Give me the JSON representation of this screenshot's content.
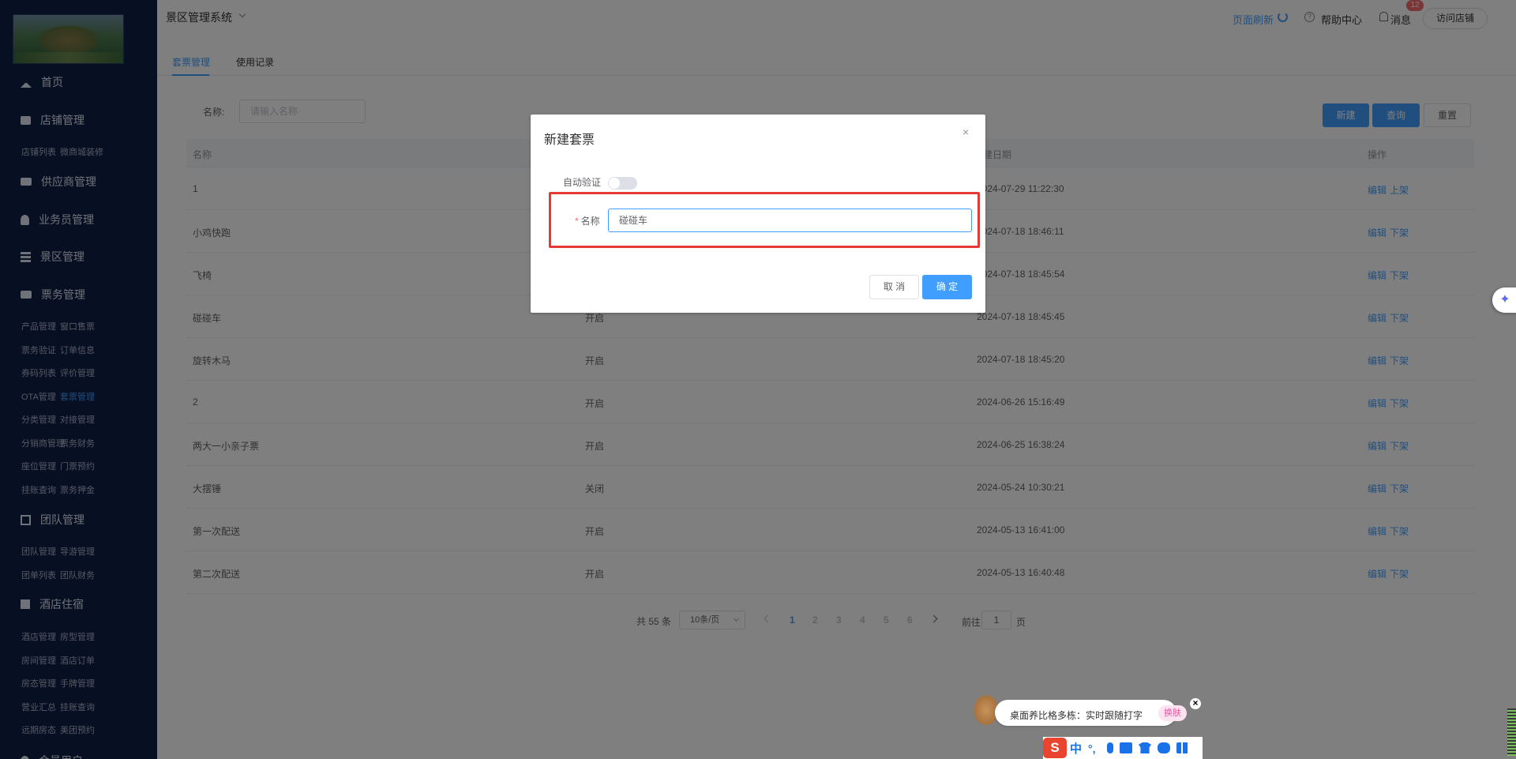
{
  "sidebar": {
    "groups": [
      {
        "label": "首页",
        "icon": "home-icon"
      },
      {
        "label": "店铺管理",
        "icon": "store-icon"
      },
      {
        "label": "供应商管理",
        "icon": "truck-icon"
      },
      {
        "label": "业务员管理",
        "icon": "user-icon"
      },
      {
        "label": "景区管理",
        "icon": "stack-icon"
      },
      {
        "label": "票务管理",
        "icon": "ticket-icon"
      },
      {
        "label": "团队管理",
        "icon": "cube-icon"
      },
      {
        "label": "酒店住宿",
        "icon": "hotel-icon"
      },
      {
        "label": "会员用户",
        "icon": "member-icon"
      }
    ],
    "shop_sub": [
      "店铺列表",
      "微商城装修"
    ],
    "ticket_sub": [
      [
        "产品管理",
        "窗口售票"
      ],
      [
        "票务验证",
        "订单信息"
      ],
      [
        "券码列表",
        "评价管理"
      ],
      [
        "OTA管理",
        "套票管理"
      ],
      [
        "分类管理",
        "对接管理"
      ],
      [
        "分销商管理",
        "票务财务"
      ],
      [
        "座位管理",
        "门票预约"
      ],
      [
        "挂账查询",
        "票务押金"
      ]
    ],
    "team_sub": [
      [
        "团队管理",
        "导游管理"
      ],
      [
        "团单列表",
        "团队财务"
      ]
    ],
    "hotel_sub": [
      [
        "酒店管理",
        "房型管理"
      ],
      [
        "房间管理",
        "酒店订单"
      ],
      [
        "房态管理",
        "手牌管理"
      ],
      [
        "营业汇总",
        "挂账查询"
      ],
      [
        "远期房态",
        "美团预约"
      ]
    ],
    "active_item": "套票管理"
  },
  "header": {
    "system_title": "景区管理系统",
    "refresh": "页面刷新",
    "help": "帮助中心",
    "messages": "消息",
    "message_count": "12",
    "visit_store": "访问店铺"
  },
  "tabs": [
    {
      "label": "套票管理",
      "active": true
    },
    {
      "label": "使用记录",
      "active": false
    }
  ],
  "search": {
    "name_label": "名称:",
    "placeholder": "请输入名称",
    "new_button": "新建",
    "query_button": "查询",
    "reset_button": "重置"
  },
  "table": {
    "headers": {
      "name": "名称",
      "date": "建日期",
      "action": "操作"
    },
    "rows": [
      {
        "name": "1",
        "status": "",
        "date": "2024-07-29 11:22:30",
        "edit": "编辑",
        "toggle": "上架"
      },
      {
        "name": "小鸡快跑",
        "status": "",
        "date": "2024-07-18 18:46:11",
        "edit": "编辑",
        "toggle": "下架"
      },
      {
        "name": "飞椅",
        "status": "",
        "date": "2024-07-18 18:45:54",
        "edit": "编辑",
        "toggle": "下架"
      },
      {
        "name": "碰碰车",
        "status": "开启",
        "date": "2024-07-18 18:45:45",
        "edit": "编辑",
        "toggle": "下架"
      },
      {
        "name": "旋转木马",
        "status": "开启",
        "date": "2024-07-18 18:45:20",
        "edit": "编辑",
        "toggle": "下架"
      },
      {
        "name": "2",
        "status": "开启",
        "date": "2024-06-26 15:16:49",
        "edit": "编辑",
        "toggle": "下架"
      },
      {
        "name": "两大一小亲子票",
        "status": "开启",
        "date": "2024-06-25 16:38:24",
        "edit": "编辑",
        "toggle": "下架"
      },
      {
        "name": "大摆锤",
        "status": "关闭",
        "date": "2024-05-24 10:30:21",
        "edit": "编辑",
        "toggle": "下架"
      },
      {
        "name": "第一次配送",
        "status": "开启",
        "date": "2024-05-13 16:41:00",
        "edit": "编辑",
        "toggle": "下架"
      },
      {
        "name": "第二次配送",
        "status": "开启",
        "date": "2024-05-13 16:40:48",
        "edit": "编辑",
        "toggle": "下架"
      }
    ]
  },
  "pagination": {
    "total": "共 55 条",
    "page_size": "10条/页",
    "pages": [
      "1",
      "2",
      "3",
      "4",
      "5",
      "6"
    ],
    "current": "1",
    "goto_label": "前往",
    "goto_value": "1",
    "page_suffix": "页"
  },
  "dialog": {
    "title": "新建套票",
    "close": "×",
    "auto_verify_label": "自动验证",
    "auto_verify_on": false,
    "name_required": "*",
    "name_label": "名称",
    "name_value": "碰碰车",
    "cancel": "取 消",
    "confirm": "确 定"
  },
  "ime": {
    "tip": "桌面养比格多栋：实时跟随打字",
    "chip": "换肤",
    "close": "×",
    "logo": "S",
    "mode": "中",
    "punct": "°,"
  },
  "assistant": {
    "icon": "sparkle-icon",
    "glyph": "✦"
  },
  "colors": {
    "sidebar_bg": "#0f1f45",
    "primary": "#409eff",
    "highlight": "#e53935"
  }
}
